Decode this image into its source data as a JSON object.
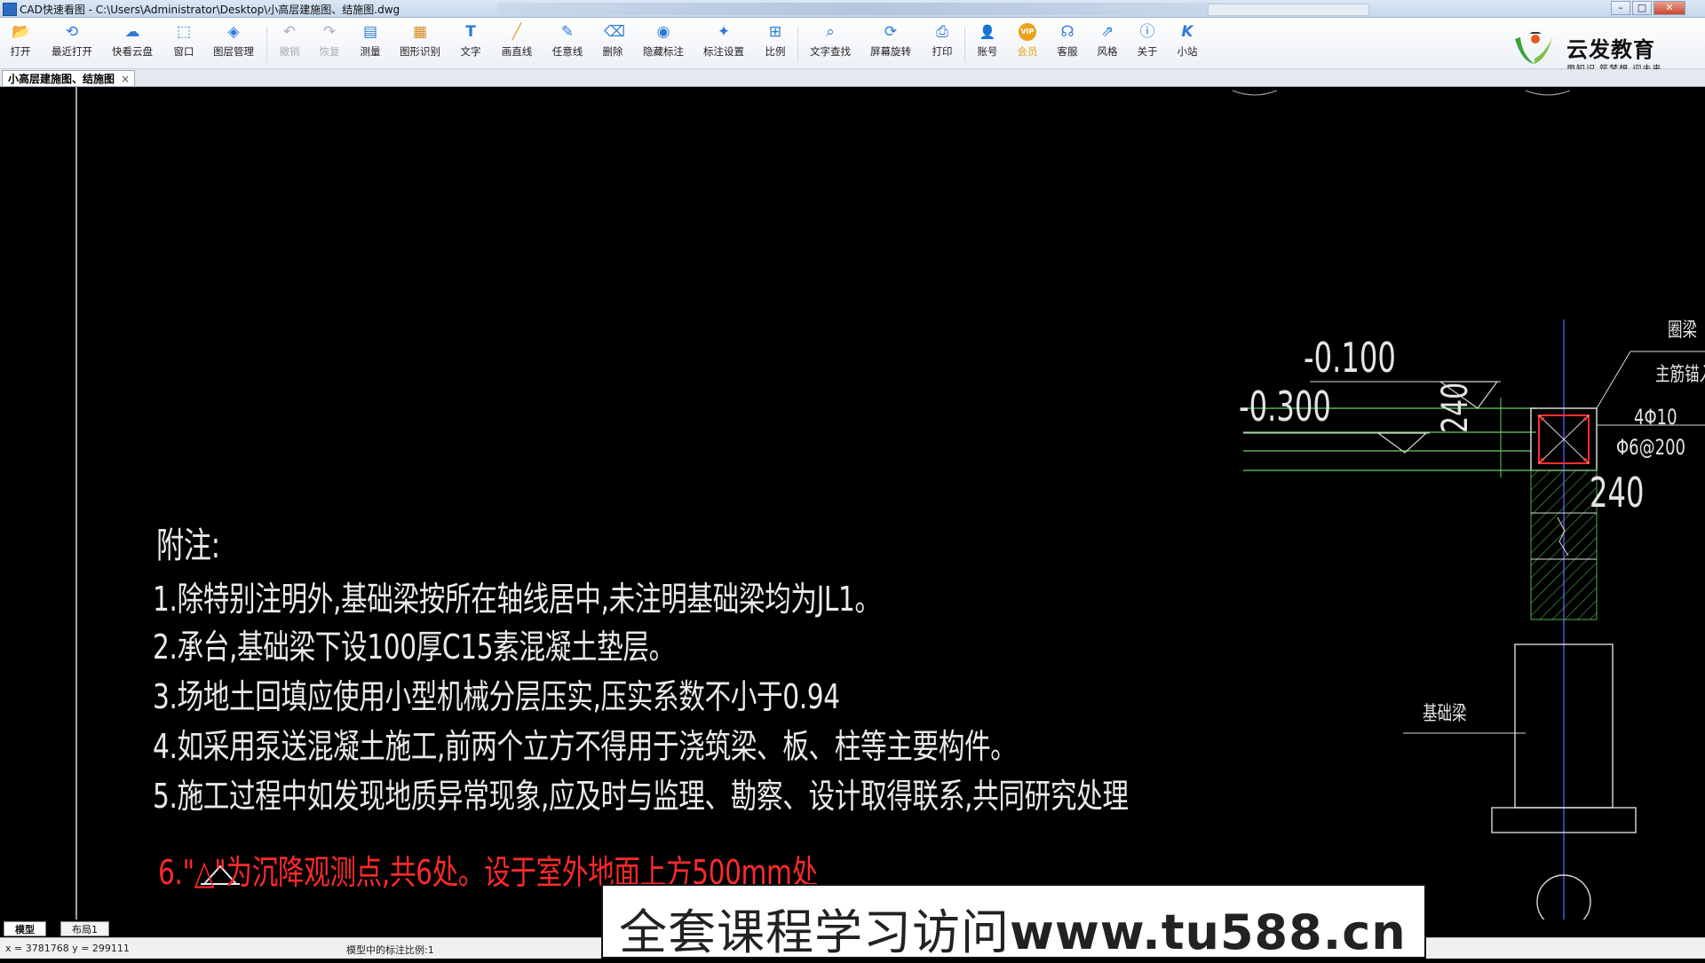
{
  "window": {
    "title": "CAD快速看图 - C:\\Users\\Administrator\\Desktop\\小高层建施图、结施图.dwg",
    "minimize": "–",
    "maximize": "□",
    "close": "✕"
  },
  "toolbar": {
    "items": [
      {
        "label": "打开",
        "icon": "📂"
      },
      {
        "label": "最近打开",
        "icon": "⟲"
      },
      {
        "label": "快看云盘",
        "icon": "☁"
      },
      {
        "label": "窗口",
        "icon": "⬚"
      },
      {
        "label": "图层管理",
        "icon": "◈"
      },
      {
        "label": "撤销",
        "icon": "↶"
      },
      {
        "label": "恢复",
        "icon": "↷"
      },
      {
        "label": "测量",
        "icon": "▤"
      },
      {
        "label": "图形识别",
        "icon": "▦"
      },
      {
        "label": "文字",
        "icon": "T"
      },
      {
        "label": "画直线",
        "icon": "╱"
      },
      {
        "label": "任意线",
        "icon": "✎"
      },
      {
        "label": "删除",
        "icon": "⌫"
      },
      {
        "label": "隐藏标注",
        "icon": "◉"
      },
      {
        "label": "标注设置",
        "icon": "✦"
      },
      {
        "label": "比例",
        "icon": "⊞"
      },
      {
        "label": "文字查找",
        "icon": "⌕"
      },
      {
        "label": "屏幕旋转",
        "icon": "⟳"
      },
      {
        "label": "打印",
        "icon": "⎙"
      },
      {
        "label": "账号",
        "icon": "👤"
      },
      {
        "label": "会员",
        "icon": "VIP"
      },
      {
        "label": "客服",
        "icon": "☊"
      },
      {
        "label": "风格",
        "icon": "⇗"
      },
      {
        "label": "关于",
        "icon": "ⓘ"
      },
      {
        "label": "小站",
        "icon": "K"
      }
    ]
  },
  "logo": {
    "name": "云发教育",
    "slogan": "用知识 筑梦想 迎未来"
  },
  "document_tab": {
    "label": "小高层建施图、结施图",
    "close": "×"
  },
  "notes": {
    "heading": "附注:",
    "items": [
      "1.除特别注明外,基础梁按所在轴线居中,未注明基础梁均为JL1。",
      "2.承台,基础梁下设100厚C15素混凝土垫层。",
      "3.场地土回填应使用小型机械分层压实,压实系数不小于0.94",
      "4.如采用泵送混凝土施工,前两个立方不得用于浇筑梁、板、柱等主要构件。",
      "5.施工过程中如发现地质异常现象,应及时与监理、勘察、设计取得联系,共同研究处理",
      "6.\"△\"为沉降观测点,共6处。设于室外地面上方500mm处"
    ]
  },
  "drawing": {
    "elev_1": "-0.100",
    "elev_2": "-0.300",
    "dim_1": "240",
    "dim_2": "240",
    "label_ring_beam": "圈梁",
    "label_main_bar": "主筋锚入",
    "rebar_1": "4Φ10",
    "rebar_2": "Φ6@200",
    "label_foundation_beam": "基础梁"
  },
  "layout_tabs": [
    "模型",
    "布局1"
  ],
  "status": {
    "coords": "x = 3781768  y = 299111",
    "scale": "模型中的标注比例:1"
  },
  "watermark": {
    "prefix": "全套课程学习访问",
    "url": "www.tu588.cn"
  }
}
